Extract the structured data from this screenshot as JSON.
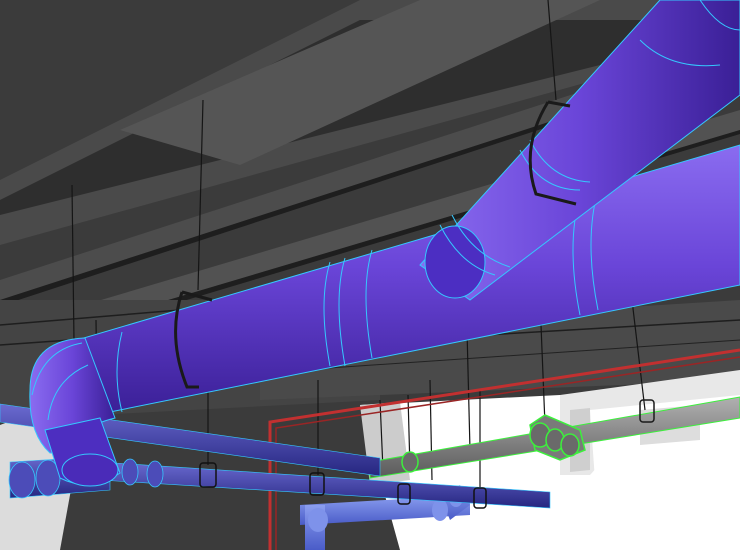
{
  "scene": {
    "kind": "3d-bim-ceiling-render",
    "colors": {
      "ceiling_dark": "#3a3a3a",
      "ceiling_mid": "#4a4a4a",
      "beam_light": "#5a5a5a",
      "beam_edge": "#1e1e1e",
      "duct_purple": "#6a45d8",
      "duct_purple_dark": "#3a1f96",
      "duct_outline": "#35c8ff",
      "pipe_blue": "#3e3e9e",
      "pipe_light_blue": "#7890e8",
      "pipe_gray": "#8c8c8c",
      "pipe_green_outline": "#3cf03c",
      "pipe_red": "#c23030",
      "hanger": "#1a1a1a",
      "floor_white": "#ffffff",
      "wall_gray": "#dcdcdc"
    }
  }
}
